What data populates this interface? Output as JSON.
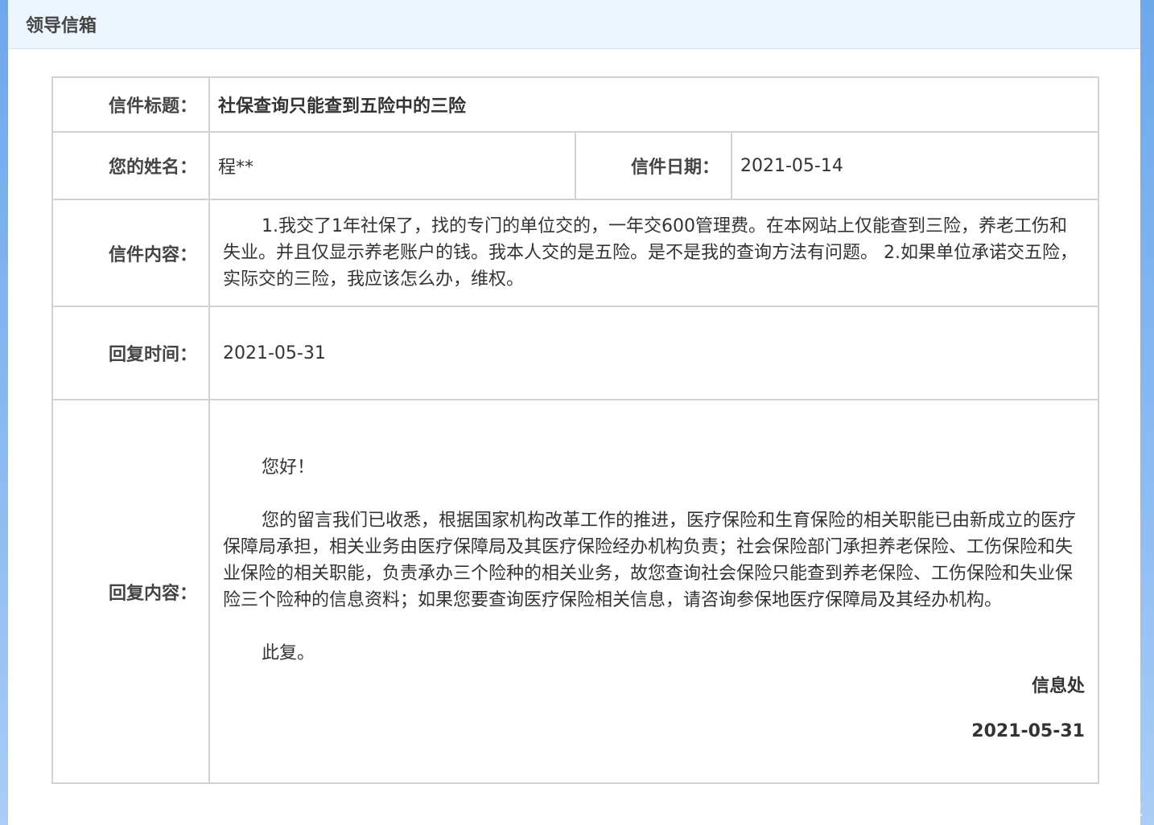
{
  "header": {
    "title": "领导信箱"
  },
  "letter": {
    "title_label": "信件标题：",
    "title_value": "社保查询只能查到五险中的三险",
    "name_label": "您的姓名：",
    "name_value": "程**",
    "date_label": "信件日期：",
    "date_value": "2021-05-14",
    "content_label": "信件内容：",
    "content_value": "1.我交了1年社保了，找的专门的单位交的，一年交600管理费。在本网站上仅能查到三险，养老工伤和失业。并且仅显示养老账户的钱。我本人交的是五险。是不是我的查询方法有问题。 2.如果单位承诺交五险，实际交的三险，我应该怎么办，维权。",
    "reply_time_label": "回复时间：",
    "reply_time_value": "2021-05-31",
    "reply_content_label": "回复内容：",
    "reply": {
      "greeting": "您好！",
      "body": "您的留言我们已收悉，根据国家机构改革工作的推进，医疗保险和生育保险的相关职能已由新成立的医疗保障局承担，相关业务由医疗保障局及其医疗保险经办机构负责；社会保险部门承担养老保险、工伤保险和失业保险的相关职能，负责承办三个险种的相关业务，故您查询社会保险只能查到养老保险、工伤保险和失业保险三个险种的信息资料；如果您要查询医疗保险相关信息，请咨询参保地医疗保障局及其经办机构。",
      "closing": "此复。",
      "signature": "信息处",
      "signature_date": "2021-05-31"
    }
  },
  "watermark": "CSDN @爬不上树的小松鼠"
}
